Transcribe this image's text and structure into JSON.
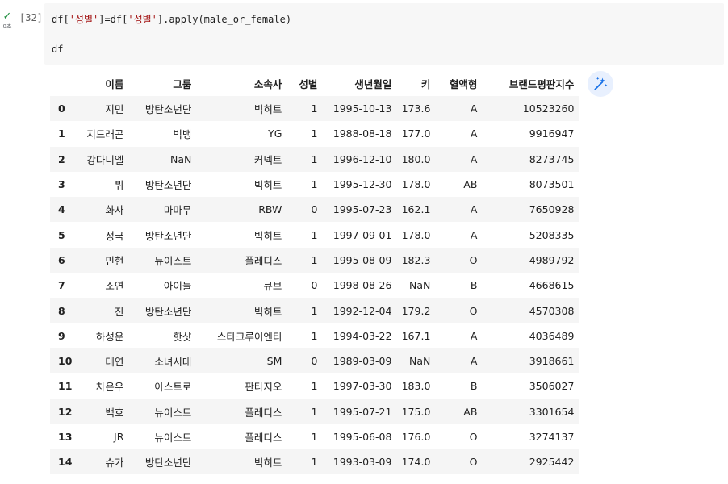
{
  "cell": {
    "status_check": "✓",
    "exec_time": "0초",
    "execution_count": "[32]",
    "code_line1": {
      "a": "df[",
      "b": "'성별'",
      "c": "]=df[",
      "d": "'성별'",
      "e": "].apply(male_or_female)"
    },
    "code_line2": "df"
  },
  "dataframe": {
    "columns": [
      "",
      "이름",
      "그룹",
      "소속사",
      "성별",
      "생년월일",
      "키",
      "혈액형",
      "브랜드평판지수"
    ],
    "rows": [
      [
        "0",
        "지민",
        "방탄소년단",
        "빅히트",
        "1",
        "1995-10-13",
        "173.6",
        "A",
        "10523260"
      ],
      [
        "1",
        "지드래곤",
        "빅뱅",
        "YG",
        "1",
        "1988-08-18",
        "177.0",
        "A",
        "9916947"
      ],
      [
        "2",
        "강다니엘",
        "NaN",
        "커넥트",
        "1",
        "1996-12-10",
        "180.0",
        "A",
        "8273745"
      ],
      [
        "3",
        "뷔",
        "방탄소년단",
        "빅히트",
        "1",
        "1995-12-30",
        "178.0",
        "AB",
        "8073501"
      ],
      [
        "4",
        "화사",
        "마마무",
        "RBW",
        "0",
        "1995-07-23",
        "162.1",
        "A",
        "7650928"
      ],
      [
        "5",
        "정국",
        "방탄소년단",
        "빅히트",
        "1",
        "1997-09-01",
        "178.0",
        "A",
        "5208335"
      ],
      [
        "6",
        "민현",
        "뉴이스트",
        "플레디스",
        "1",
        "1995-08-09",
        "182.3",
        "O",
        "4989792"
      ],
      [
        "7",
        "소연",
        "아이들",
        "큐브",
        "0",
        "1998-08-26",
        "NaN",
        "B",
        "4668615"
      ],
      [
        "8",
        "진",
        "방탄소년단",
        "빅히트",
        "1",
        "1992-12-04",
        "179.2",
        "O",
        "4570308"
      ],
      [
        "9",
        "하성운",
        "핫샷",
        "스타크루이엔티",
        "1",
        "1994-03-22",
        "167.1",
        "A",
        "4036489"
      ],
      [
        "10",
        "태연",
        "소녀시대",
        "SM",
        "0",
        "1989-03-09",
        "NaN",
        "A",
        "3918661"
      ],
      [
        "11",
        "차은우",
        "아스트로",
        "판타지오",
        "1",
        "1997-03-30",
        "183.0",
        "B",
        "3506027"
      ],
      [
        "12",
        "백호",
        "뉴이스트",
        "플레디스",
        "1",
        "1995-07-21",
        "175.0",
        "AB",
        "3301654"
      ],
      [
        "13",
        "JR",
        "뉴이스트",
        "플레디스",
        "1",
        "1995-06-08",
        "176.0",
        "O",
        "3274137"
      ],
      [
        "14",
        "슈가",
        "방탄소년단",
        "빅히트",
        "1",
        "1993-03-09",
        "174.0",
        "O",
        "2925442"
      ]
    ]
  },
  "icons": {
    "check": "check-icon",
    "magic": "magic-wand-icon"
  },
  "colors": {
    "code_bg": "#f7f7f7",
    "string": "#a31515",
    "check": "#1e8e3e",
    "row_stripe": "#f5f5f5",
    "magic_bg": "#e8f0fe",
    "magic_fg": "#1a73e8"
  }
}
